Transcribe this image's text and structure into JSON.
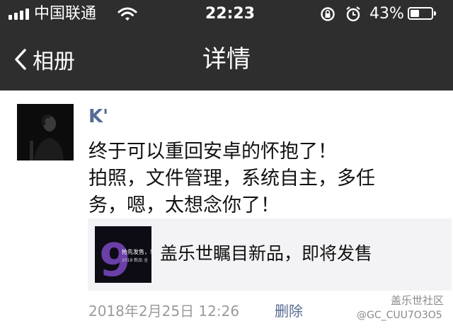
{
  "status_bar": {
    "carrier": "中国联通",
    "time": "22:23",
    "battery_percent": "43%",
    "battery_level": 0.43,
    "icons": [
      "signal-icon",
      "wifi-icon",
      "rotation-lock-icon",
      "alarm-icon",
      "battery-icon"
    ]
  },
  "nav": {
    "back_label": "相册",
    "title": "详情"
  },
  "post": {
    "username": "K'",
    "text_lines": [
      "终于可以重回安卓的怀抱了！",
      "拍照，文件管理，系统自主，多任",
      "务，嗯，太想念你了！"
    ],
    "link": {
      "title": "盖乐世瞩目新品，即将发售",
      "thumb_number": "9",
      "thumb_caption": "抢先发售，想",
      "thumb_caption_2": "2018 新品 全"
    },
    "timestamp": "2018年2月25日 12:26",
    "delete_label": "删除"
  },
  "watermark": {
    "line1": "盖乐世社区",
    "line2": "@GC_CUU7O3O5"
  },
  "colors": {
    "bar_background": "#2e2e2e",
    "link_blue": "#576b95",
    "timestamp_gray": "#9b9b9b",
    "card_background": "#f3f3f5"
  }
}
